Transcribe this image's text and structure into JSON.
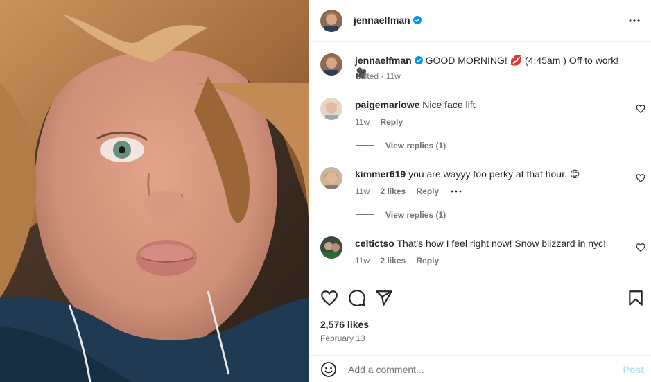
{
  "post": {
    "author": "jennaelfman",
    "caption": "GOOD MORNING! 💋 (4:45am ) Off to work! 🎥",
    "edited_label": "Edited",
    "age": "11w",
    "likes": "2,576 likes",
    "date": "February 13"
  },
  "comments": [
    {
      "username": "paigemarlowe",
      "text": "Nice face lift",
      "age": "11w",
      "likes": "",
      "reply_label": "Reply",
      "view_replies": "View replies (1)"
    },
    {
      "username": "kimmer619",
      "text": "you are wayyy too perky at that hour. 😊",
      "age": "11w",
      "likes": "2 likes",
      "reply_label": "Reply",
      "view_replies": "View replies (1)"
    },
    {
      "username": "celticts​o",
      "text": "That's how I feel right now! Snow blizzard in nyc!",
      "age": "11w",
      "likes": "2 likes",
      "reply_label": "Reply"
    }
  ],
  "composer": {
    "placeholder": "Add a comment...",
    "post_label": "Post"
  },
  "icons": {
    "verified": "verified-badge-icon",
    "more": "more-options-icon",
    "like": "heart-icon",
    "comment": "comment-bubble-icon",
    "share": "paper-plane-icon",
    "save": "bookmark-icon",
    "emoji": "emoji-smile-icon"
  },
  "colors": {
    "verified": "#0095f6",
    "post_button": "#b2dffc",
    "text": "#262626",
    "muted": "#737373"
  }
}
